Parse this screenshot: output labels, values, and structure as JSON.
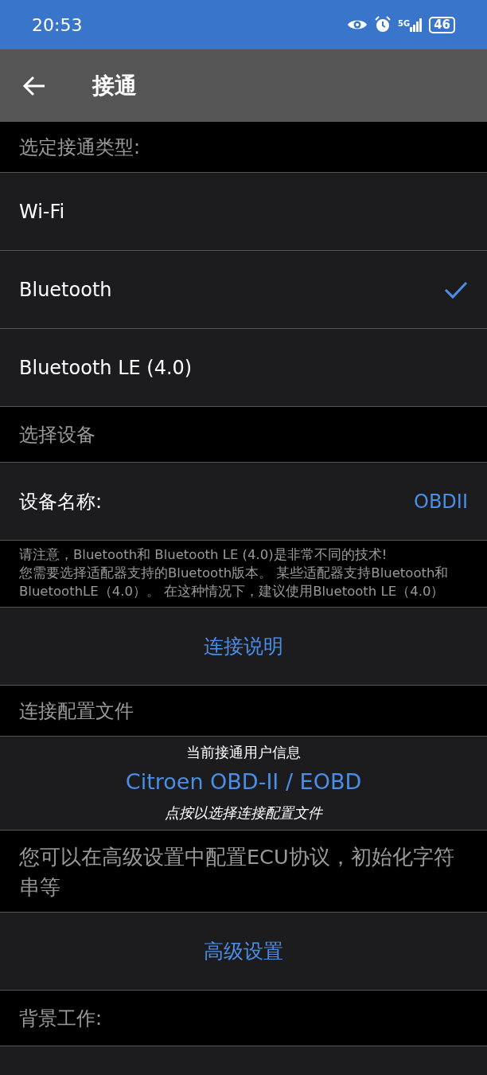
{
  "status_bar": {
    "time": "20:53",
    "network": "5G",
    "battery": "46"
  },
  "app_bar": {
    "title": "接通"
  },
  "items": [
    {
      "kind": "header",
      "text": "选定接通类型:"
    },
    {
      "kind": "option",
      "text": "Wi-Fi",
      "selected": false
    },
    {
      "kind": "option",
      "text": "Bluetooth",
      "selected": true
    },
    {
      "kind": "option",
      "text": "Bluetooth LE (4.0)",
      "selected": false
    },
    {
      "kind": "header",
      "text": "选择设备"
    },
    {
      "kind": "setting",
      "text": "设备名称:",
      "value": "OBDII"
    },
    {
      "kind": "note",
      "lines": [
        "请注意，Bluetooth和 Bluetooth LE (4.0)是非常不同的技术!",
        "您需要选择适配器支持的Bluetooth版本。 某些适配器支持Bluetooth和 BluetoothLE（4.0）。 在这种情况下，建议使用Bluetooth LE（4.0）"
      ]
    },
    {
      "kind": "action",
      "text": "连接说明"
    },
    {
      "kind": "header",
      "text": "连接配置文件"
    },
    {
      "kind": "profile",
      "caption": "当前接通用户信息",
      "value": "Citroen OBD-II / EOBD",
      "hint": "点按以选择连接配置文件"
    },
    {
      "kind": "info",
      "text": "您可以在高级设置中配置ECU协议，初始化字符串等"
    },
    {
      "kind": "action",
      "text": "高级设置"
    },
    {
      "kind": "header",
      "text": "背景工作:"
    }
  ]
}
